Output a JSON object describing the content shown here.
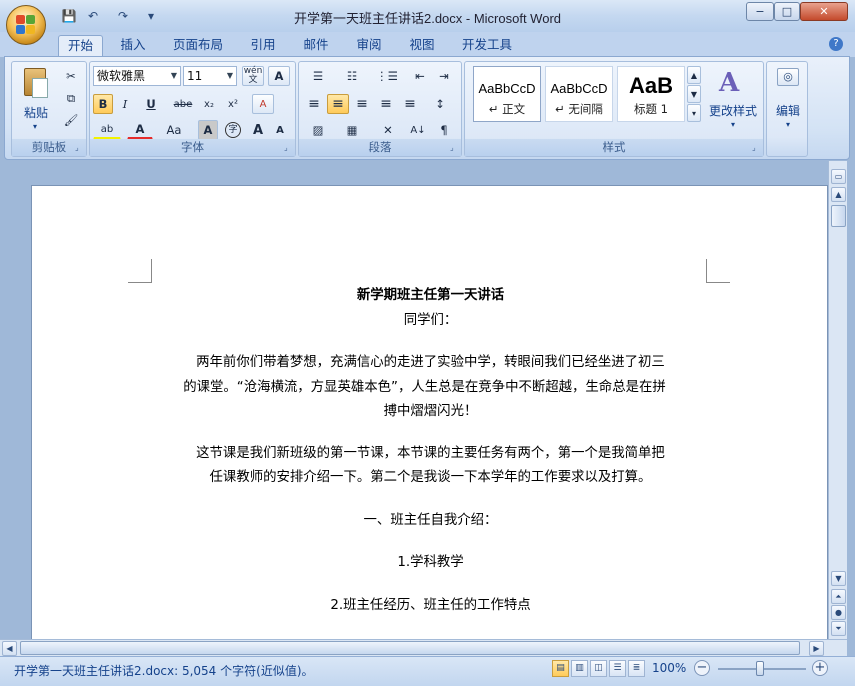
{
  "window": {
    "title": "开学第一天班主任讲话2.docx - Microsoft Word",
    "minimize_icon": "−",
    "maximize_icon": "□",
    "close_icon": "✕"
  },
  "qat": {
    "save_icon": "💾",
    "undo_icon": "↶",
    "redo_icon": "↷",
    "customize_icon": "▾"
  },
  "tabs": [
    {
      "label": "开始",
      "active": true
    },
    {
      "label": "插入"
    },
    {
      "label": "页面布局"
    },
    {
      "label": "引用"
    },
    {
      "label": "邮件"
    },
    {
      "label": "审阅"
    },
    {
      "label": "视图"
    },
    {
      "label": "开发工具"
    }
  ],
  "help_icon": "?",
  "ribbon": {
    "clipboard": {
      "label": "剪贴板",
      "paste_label": "粘贴",
      "paste_arrow": "▾",
      "cut_icon": "✂",
      "copy_icon": "⧉",
      "painter_icon": "🖌"
    },
    "font": {
      "label": "字体",
      "font_name": "微软雅黑",
      "font_size": "11",
      "wen_label": "wén\n文",
      "A_label": "A",
      "bold": "B",
      "italic": "I",
      "underline": "U",
      "strike": "abe",
      "subscript": "x₂",
      "superscript": "x²",
      "clear_format": "A",
      "highlight": "ab",
      "font_color": "A",
      "change_case": "Aa",
      "char_shading": "A",
      "enclose": "字",
      "grow": "A",
      "shrink": "A"
    },
    "paragraph": {
      "label": "段落",
      "bullets": "☰",
      "numbering": "☷",
      "multilevel": "⋮☰",
      "dec_indent": "⇤",
      "inc_indent": "⇥",
      "align_left": "≡",
      "align_center": "≡",
      "align_right": "≡",
      "justify": "≡",
      "distribute": "≡",
      "line_spacing": "↕",
      "shading": "▨",
      "borders": "▦",
      "chinese_layout": "✕",
      "sort": "A↓",
      "show_marks": "¶"
    },
    "styles": {
      "label": "样式",
      "items": [
        {
          "sample": "AaBbCcD",
          "name": "↵ 正文"
        },
        {
          "sample": "AaBbCcD",
          "name": "↵ 无间隔"
        },
        {
          "sample": "AaB",
          "name": "标题 1"
        }
      ],
      "change_styles": "更改样式",
      "change_arrow": "▾"
    },
    "editing": {
      "label": "编辑",
      "arrow": "▾"
    }
  },
  "document": {
    "title": "新学期班主任第一天讲话",
    "greeting": "同学们：",
    "p1_line1": "两年前你们带着梦想，充满信心的走进了实验中学，转眼间我们已经坐进了初三",
    "p1_line2": "的课堂。“沧海横流，方显英雄本色”，人生总是在竞争中不断超越，生命总是在拼",
    "p1_line3": "搏中熠熠闪光！",
    "p2_line1": "这节课是我们新班级的第一节课，本节课的主要任务有两个，第一个是我简单把",
    "p2_line2": "任课教师的安排介绍一下。第二个是我谈一下本学年的工作要求以及打算。",
    "h1": "一、班主任自我介绍：",
    "h2": "1.学科教学",
    "h3": "2.班主任经历、班主任的工作特点"
  },
  "status": {
    "text": "开学第一天班主任讲话2.docx: 5,054 个字符(近似值)。",
    "zoom": "100%",
    "zoom_out": "−",
    "zoom_in": "+"
  }
}
